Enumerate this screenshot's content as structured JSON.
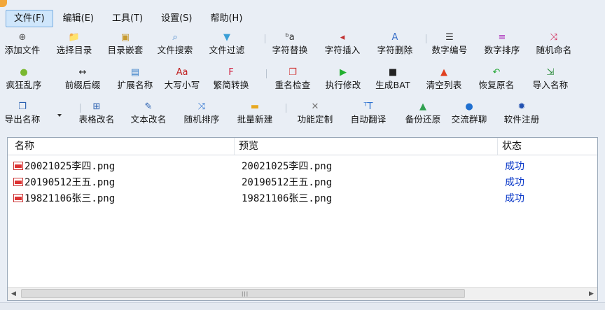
{
  "menu": [
    {
      "label": "文件(F)",
      "active": true
    },
    {
      "label": "编辑(E)",
      "active": false
    },
    {
      "label": "工具(T)",
      "active": false
    },
    {
      "label": "设置(S)",
      "active": false
    },
    {
      "label": "帮助(H)",
      "active": false
    }
  ],
  "toolbar": {
    "row1": [
      {
        "label": "添加文件",
        "icon": "add-file-icon",
        "glyph": "⊕",
        "color": "#555555"
      },
      {
        "label": "选择目录",
        "icon": "folder-icon",
        "glyph": "📁",
        "color": "#e0a520"
      },
      {
        "label": "目录嵌套",
        "icon": "folder-nest-icon",
        "glyph": "▣",
        "color": "#c79a2e"
      },
      {
        "label": "文件搜索",
        "icon": "search-icon",
        "glyph": "⌕",
        "color": "#3a80c9"
      },
      {
        "label": "文件过滤",
        "icon": "filter-icon",
        "glyph": "▼",
        "color": "#3b9fd6"
      },
      {
        "label": "字符替换",
        "icon": "replace-chars-icon",
        "glyph": "ᵇa",
        "color": "#333333"
      },
      {
        "label": "字符插入",
        "icon": "insert-chars-icon",
        "glyph": "◂",
        "color": "#c03030"
      },
      {
        "label": "字符删除",
        "icon": "delete-chars-icon",
        "glyph": "A",
        "color": "#3a70c9"
      },
      {
        "label": "数字编号",
        "icon": "number-list-icon",
        "glyph": "☰",
        "color": "#333333"
      },
      {
        "label": "数字排序",
        "icon": "sort-icon",
        "glyph": "≡",
        "color": "#b040c0"
      },
      {
        "label": "随机命名",
        "icon": "shuffle-icon",
        "glyph": "⤨",
        "color": "#d02050"
      }
    ],
    "row2": [
      {
        "label": "疯狂乱序",
        "icon": "crazy-face-icon",
        "glyph": "●",
        "color": "#7ab830"
      },
      {
        "label": "前缀后缀",
        "icon": "prefix-suffix-icon",
        "glyph": "↔",
        "color": "#222222"
      },
      {
        "label": "扩展名称",
        "icon": "extension-icon",
        "glyph": "▤",
        "color": "#3a80c9"
      },
      {
        "label": "大写小写",
        "icon": "case-icon",
        "glyph": "Aa",
        "color": "#c02020"
      },
      {
        "label": "繁简转换",
        "icon": "convert-icon",
        "glyph": "F",
        "color": "#d02040"
      },
      {
        "label": "重名检查",
        "icon": "duplicate-check-icon",
        "glyph": "❐",
        "color": "#d03030"
      },
      {
        "label": "执行修改",
        "icon": "play-icon",
        "glyph": "▶",
        "color": "#22b030"
      },
      {
        "label": "生成BAT",
        "icon": "terminal-icon",
        "glyph": "■",
        "color": "#222222"
      },
      {
        "label": "清空列表",
        "icon": "clear-list-icon",
        "glyph": "▲",
        "color": "#e04020"
      },
      {
        "label": "恢复原名",
        "icon": "undo-icon",
        "glyph": "↶",
        "color": "#28a838"
      },
      {
        "label": "导入名称",
        "icon": "import-icon",
        "glyph": "⇲",
        "color": "#2a8a3a"
      }
    ],
    "row3": [
      {
        "label": "导出名称",
        "icon": "export-icon",
        "glyph": "❐",
        "color": "#2a60b0"
      },
      {
        "label": "表格改名",
        "icon": "table-icon",
        "glyph": "⊞",
        "color": "#2a60b0"
      },
      {
        "label": "文本改名",
        "icon": "text-edit-icon",
        "glyph": "✎",
        "color": "#2a60b0"
      },
      {
        "label": "随机排序",
        "icon": "random-sort-icon",
        "glyph": "⤨",
        "color": "#2a70d0"
      },
      {
        "label": "批量新建",
        "icon": "new-folder-icon",
        "glyph": "▬",
        "color": "#e8a820"
      },
      {
        "label": "功能定制",
        "icon": "tools-icon",
        "glyph": "✕",
        "color": "#777777"
      },
      {
        "label": "自动翻译",
        "icon": "translate-icon",
        "glyph": "ᵀT",
        "color": "#2a70d0"
      },
      {
        "label": "备份还原",
        "icon": "drive-icon",
        "glyph": "▲",
        "color": "#30a050"
      },
      {
        "label": "交流群聊",
        "icon": "chat-icon",
        "glyph": "●",
        "color": "#2070d0"
      },
      {
        "label": "软件注册",
        "icon": "gear-icon",
        "glyph": "✹",
        "color": "#2050b0"
      }
    ]
  },
  "list": {
    "columns": [
      "名称",
      "预览",
      "状态"
    ],
    "rows": [
      {
        "name": "20021025李四.png",
        "preview": "20021025李四.png",
        "status": "成功"
      },
      {
        "name": "20190512王五.png",
        "preview": "20190512王五.png",
        "status": "成功"
      },
      {
        "name": "19821106张三.png",
        "preview": "19821106张三.png",
        "status": "成功"
      }
    ]
  },
  "colors": {
    "status_success": "#0a38c8",
    "menu_active_bg": "#cfe6fb",
    "window_bg": "#e9eef5"
  }
}
